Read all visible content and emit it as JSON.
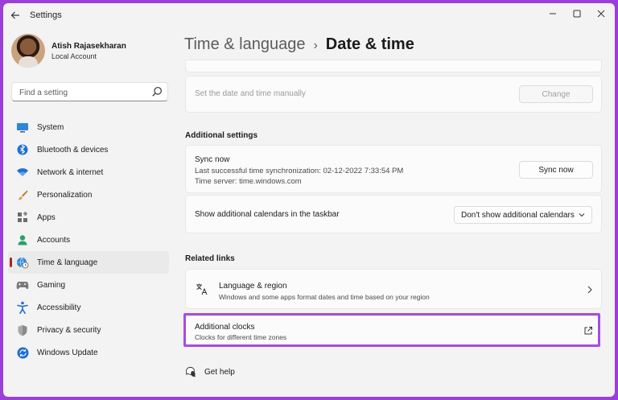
{
  "window": {
    "title": "Settings"
  },
  "profile": {
    "name": "Atish Rajasekharan",
    "account_type": "Local Account"
  },
  "search": {
    "placeholder": "Find a setting"
  },
  "sidebar": {
    "items": [
      {
        "label": "System",
        "icon": "monitor-icon"
      },
      {
        "label": "Bluetooth & devices",
        "icon": "bluetooth-icon"
      },
      {
        "label": "Network & internet",
        "icon": "wifi-icon"
      },
      {
        "label": "Personalization",
        "icon": "brush-icon"
      },
      {
        "label": "Apps",
        "icon": "apps-icon"
      },
      {
        "label": "Accounts",
        "icon": "person-icon"
      },
      {
        "label": "Time & language",
        "icon": "globe-clock-icon",
        "active": true
      },
      {
        "label": "Gaming",
        "icon": "gamepad-icon"
      },
      {
        "label": "Accessibility",
        "icon": "accessibility-icon"
      },
      {
        "label": "Privacy & security",
        "icon": "shield-icon"
      },
      {
        "label": "Windows Update",
        "icon": "update-icon"
      }
    ]
  },
  "breadcrumb": {
    "parent": "Time & language",
    "separator": "›",
    "current": "Date & time"
  },
  "manual": {
    "label": "Set the date and time manually",
    "button": "Change"
  },
  "additional_settings": {
    "title": "Additional settings",
    "sync": {
      "title": "Sync now",
      "last_sync": "Last successful time synchronization: 02-12-2022 7:33:54 PM",
      "server": "Time server: time.windows.com",
      "button": "Sync now"
    },
    "calendars": {
      "label": "Show additional calendars in the taskbar",
      "selected": "Don't show additional calendars"
    }
  },
  "related_links": {
    "title": "Related links",
    "language_region": {
      "title": "Language & region",
      "description": "Windows and some apps format dates and time based on your region"
    },
    "additional_clocks": {
      "title": "Additional clocks",
      "description": "Clocks for different time zones"
    }
  },
  "help": {
    "label": "Get help"
  },
  "colors": {
    "accent": "#a4262c",
    "highlight": "#a64de0",
    "frame": "#9b3fd6"
  }
}
